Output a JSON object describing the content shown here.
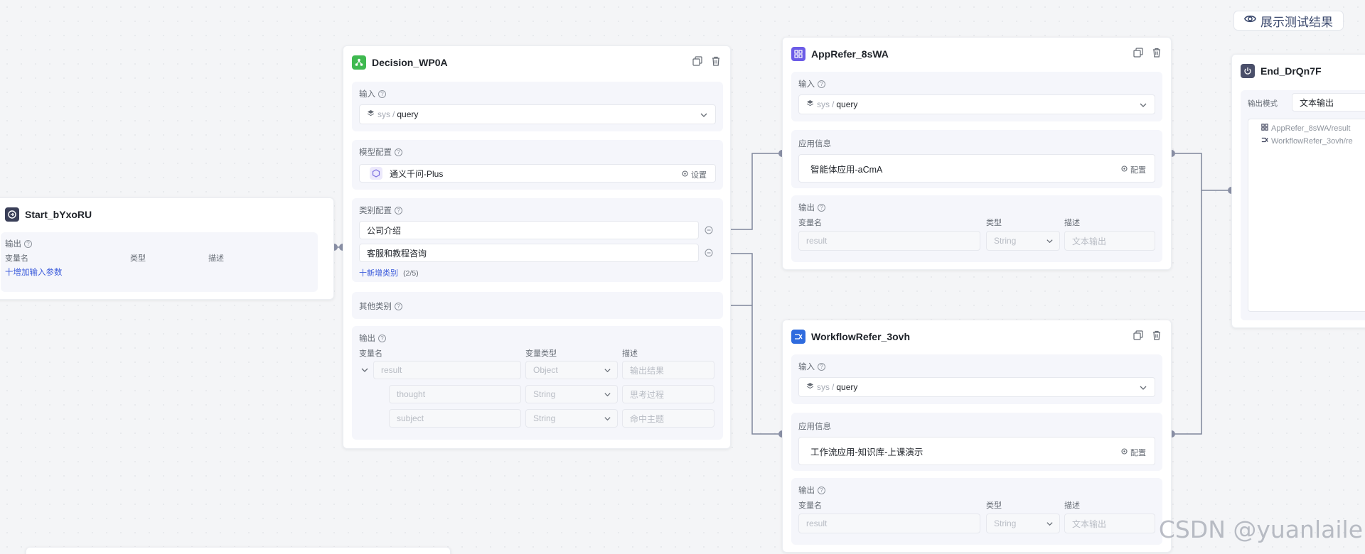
{
  "toolbar": {
    "show_results": "展示测试结果"
  },
  "watermark": "CSDN @yuanlaile",
  "start": {
    "title": "Start_bYxoRU",
    "output_label": "输出",
    "col_name": "变量名",
    "col_type": "类型",
    "col_desc": "描述",
    "add_param": "十增加输入参数"
  },
  "decision": {
    "title": "Decision_WP0A",
    "input_label": "输入",
    "input_ns": "sys",
    "input_sep": "/",
    "input_var": "query",
    "model_label": "模型配置",
    "model_name": "通义千问-Plus",
    "model_settings": "设置",
    "category_label": "类别配置",
    "categories": [
      "公司介绍",
      "客服和教程咨询"
    ],
    "add_category": "十新增类别",
    "category_count": "(2/5)",
    "other_label": "其他类别",
    "output_label": "输出",
    "col_name": "变量名",
    "col_type": "变量类型",
    "col_desc": "描述",
    "outputs": [
      {
        "name": "result",
        "type": "Object",
        "desc": "输出结果"
      },
      {
        "name": "thought",
        "type": "String",
        "desc": "思考过程"
      },
      {
        "name": "subject",
        "type": "String",
        "desc": "命中主题"
      }
    ]
  },
  "app": {
    "title": "AppRefer_8sWA",
    "input_label": "输入",
    "input_ns": "sys",
    "input_sep": "/",
    "input_var": "query",
    "info_label": "应用信息",
    "app_name": "智能体应用-aCmA",
    "config": "配置",
    "output_label": "输出",
    "col_name": "变量名",
    "col_type": "类型",
    "col_desc": "描述",
    "out_name": "result",
    "out_type": "String",
    "out_desc": "文本输出"
  },
  "workflow": {
    "title": "WorkflowRefer_3ovh",
    "input_label": "输入",
    "input_ns": "sys",
    "input_sep": "/",
    "input_var": "query",
    "info_label": "应用信息",
    "app_name": "工作流应用-知识库-上课演示",
    "config": "配置",
    "output_label": "输出",
    "col_name": "变量名",
    "col_type": "类型",
    "col_desc": "描述",
    "out_name": "result",
    "out_type": "String",
    "out_desc": "文本输出"
  },
  "end": {
    "title": "End_DrQn7F",
    "mode_label": "输出模式",
    "mode_value": "文本输出",
    "refs": [
      "AppRefer_8sWA/result",
      "WorkflowRefer_3ovh/re"
    ]
  },
  "colors": {
    "accent": "#3b5bdb",
    "edge": "#7f879c",
    "decision_icon": "#3fb950",
    "app_icon": "#6c5ce7",
    "workflow_icon": "#2f6bde",
    "end_icon": "#4a4f6a"
  }
}
